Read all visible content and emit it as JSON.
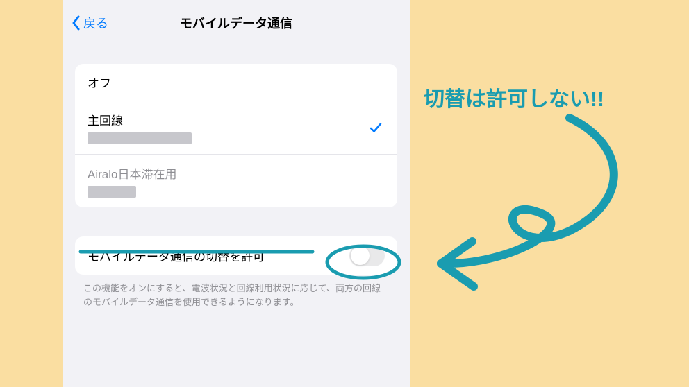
{
  "nav": {
    "back_label": "戻る",
    "title": "モバイルデータ通信"
  },
  "lines": {
    "off": "オフ",
    "primary": "主回線",
    "airalo": "Airalo日本滞在用"
  },
  "toggle_section": {
    "label": "モバイルデータ通信の切替を許可",
    "footer": "この機能をオンにすると、電波状況と回線利用状況に応じて、両方の回線のモバイルデータ通信を使用できるようになります。"
  },
  "annotation": {
    "text": "切替は許可しない!!",
    "color": "#1a9cb0"
  }
}
